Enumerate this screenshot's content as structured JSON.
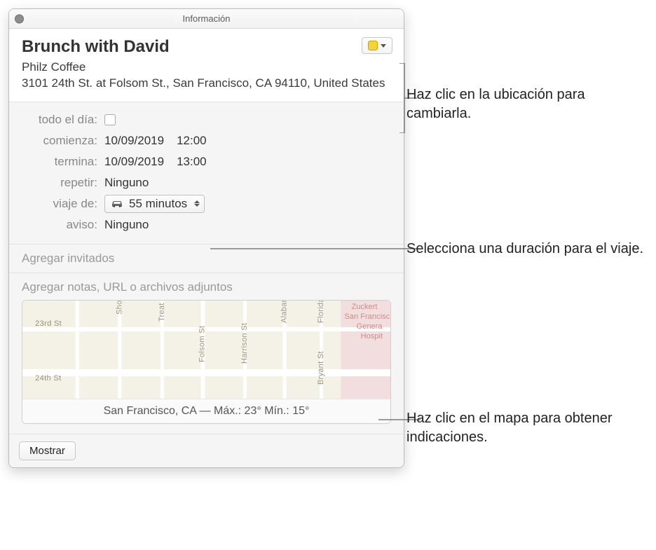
{
  "window_title": "Información",
  "event": {
    "title": "Brunch with David",
    "location_name": "Philz Coffee",
    "location_address": "3101 24th St. at Folsom St., San Francisco, CA 94110, United States",
    "fields": {
      "all_day_label": "todo el día:",
      "starts_label": "comienza:",
      "starts_date": "10/09/2019",
      "starts_time": "12:00",
      "ends_label": "termina:",
      "ends_date": "10/09/2019",
      "ends_time": "13:00",
      "repeat_label": "repetir:",
      "repeat_value": "Ninguno",
      "travel_label": "viaje de:",
      "travel_value": "55 minutos",
      "alert_label": "aviso:",
      "alert_value": "Ninguno"
    }
  },
  "invitees_placeholder": "Agregar invitados",
  "notes_placeholder": "Agregar notas, URL o archivos adjuntos",
  "map_caption": "San Francisco, CA — Máx.: 23° Mín.: 15°",
  "show_button": "Mostrar",
  "callouts": {
    "location": "Haz clic en la ubicación para cambiarla.",
    "travel": "Selecciona una duración para el viaje.",
    "map": "Haz clic en el mapa para obtener indicaciones."
  },
  "map_labels": {
    "st23": "23rd St",
    "st24": "24th St",
    "folsom": "Folsom St",
    "harrison": "Harrison St",
    "shotwell": "Shotwell St",
    "treat": "Treat Ave",
    "alabama": "Alabama St",
    "florida": "Florida St",
    "bryant": "Bryant St",
    "hospital1": "Zuckert",
    "hospital2": "San Francisc",
    "hospital3": "Genera",
    "hospital4": "Hospit"
  }
}
